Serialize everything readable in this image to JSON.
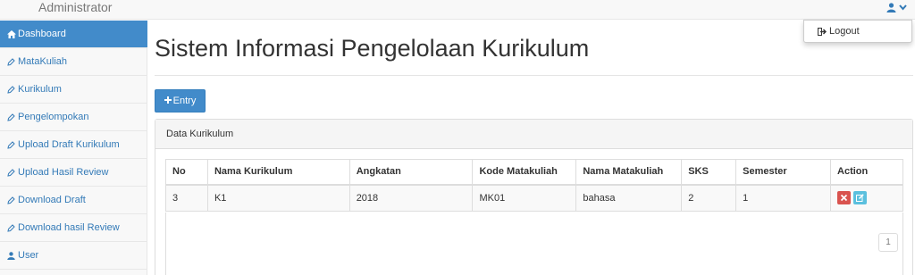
{
  "header": {
    "brand": "Administrator",
    "user_icon": "user-icon",
    "caret_icon": "caret-down-icon"
  },
  "sidebar": {
    "items": [
      {
        "label": "Dashboard",
        "icon": "home-icon",
        "active": true
      },
      {
        "label": "MataKuliah",
        "icon": "pencil-icon"
      },
      {
        "label": "Kurikulum",
        "icon": "pencil-icon"
      },
      {
        "label": "Pengelompokan",
        "icon": "pencil-icon"
      },
      {
        "label": "Upload Draft Kurikulum",
        "icon": "pencil-icon"
      },
      {
        "label": "Upload Hasil Review",
        "icon": "pencil-icon"
      },
      {
        "label": "Download Draft",
        "icon": "pencil-icon"
      },
      {
        "label": "Download hasil Review",
        "icon": "pencil-icon"
      },
      {
        "label": "User",
        "icon": "user-icon"
      }
    ]
  },
  "main": {
    "title": "Sistem Informasi Pengelolaan Kurikulum",
    "entry_button": "Entry",
    "panel_heading": "Data Kurikulum",
    "table": {
      "headers": [
        "No",
        "Nama Kurikulum",
        "Angkatan",
        "Kode Matakuliah",
        "Nama Matakuliah",
        "SKS",
        "Semester",
        "Action"
      ],
      "rows": [
        [
          "3",
          "K1",
          "2018",
          "MK01",
          "bahasa",
          "2",
          "1"
        ]
      ]
    },
    "pagination": {
      "current_page": "1"
    }
  },
  "user_menu": {
    "items": [
      {
        "label": "Logout",
        "icon": "sign-out-icon"
      }
    ]
  },
  "colors": {
    "primary": "#428bca",
    "danger": "#d9534f",
    "info": "#5bc0de",
    "link": "#337ab7"
  }
}
